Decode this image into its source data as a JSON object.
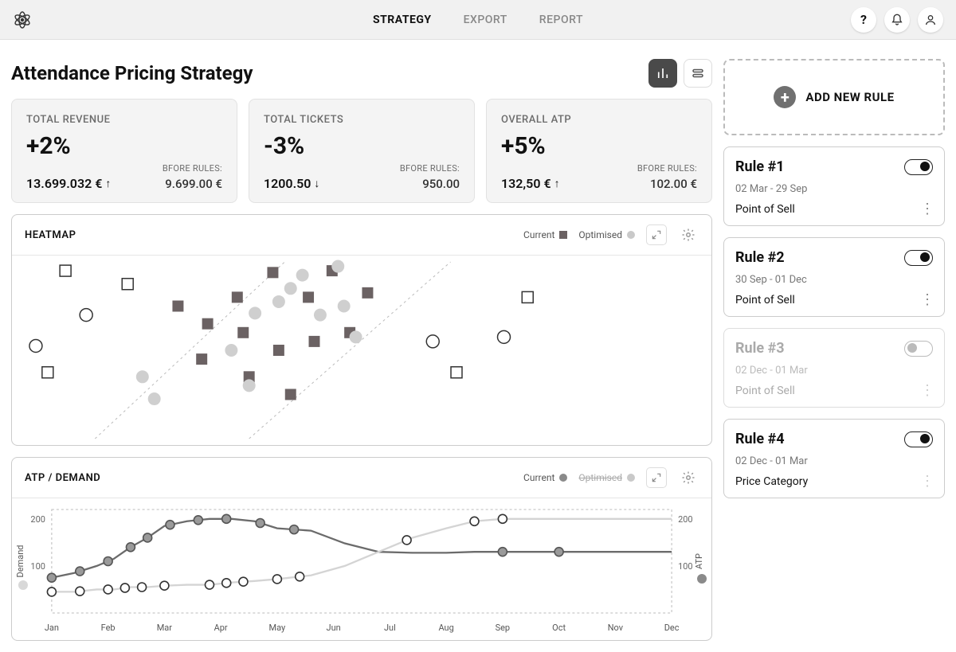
{
  "header": {
    "nav": [
      {
        "label": "STRATEGY",
        "active": true
      },
      {
        "label": "EXPORT",
        "active": false
      },
      {
        "label": "REPORT",
        "active": false
      }
    ]
  },
  "page_title": "Attendance Pricing Strategy",
  "stat_cards": {
    "before_label": "BFORE RULES:",
    "cards": [
      {
        "title": "TOTAL REVENUE",
        "pct": "+2%",
        "value": "13.699.032 €",
        "arrow": "↑",
        "before": "9.699.00 €"
      },
      {
        "title": "TOTAL TICKETS",
        "pct": "-3%",
        "value": "1200.50",
        "arrow": "↓",
        "before": "950.00"
      },
      {
        "title": "OVERALL ATP",
        "pct": "+5%",
        "value": "132,50 €",
        "arrow": "↑",
        "before": "102.00 €"
      }
    ]
  },
  "heatmap": {
    "title": "HEATMAP",
    "legend": {
      "current": "Current",
      "optimised": "Optimised"
    }
  },
  "atp": {
    "title": "ATP / DEMAND",
    "legend": {
      "current": "Current",
      "optimised": "Optimised"
    },
    "y_left_label": "Demand",
    "y_right_label": "ATP",
    "y_left_ticks": [
      "200",
      "100"
    ],
    "y_right_ticks": [
      "200",
      "100"
    ],
    "x_ticks": [
      "Jan",
      "Feb",
      "Mar",
      "Apr",
      "May",
      "Jun",
      "Jul",
      "Aug",
      "Sep",
      "Oct",
      "Nov",
      "Dec"
    ]
  },
  "sidebar": {
    "add_label": "ADD NEW RULE",
    "rules": [
      {
        "name": "Rule #1",
        "dates": "02 Mar - 29 Sep",
        "type": "Point of Sell",
        "enabled": true
      },
      {
        "name": "Rule #2",
        "dates": "30 Sep - 01 Dec",
        "type": "Point of Sell",
        "enabled": true
      },
      {
        "name": "Rule #3",
        "dates": "02 Dec - 01 Mar",
        "type": "Point of Sell",
        "enabled": false
      },
      {
        "name": "Rule #4",
        "dates": "02 Dec - 01 Mar",
        "type": "Price Category",
        "enabled": true
      }
    ]
  },
  "chart_data": [
    {
      "id": "heatmap",
      "type": "scatter",
      "x_axis": "month",
      "categories": [
        "Jan",
        "Feb",
        "Mar",
        "Apr",
        "May",
        "Jun",
        "Jul",
        "Aug",
        "Sep",
        "Oct",
        "Nov",
        "Dec"
      ],
      "series": [
        {
          "name": "Current",
          "marker": "square-filled",
          "points": [
            {
              "x": 3.4,
              "y": 150
            },
            {
              "x": 3.9,
              "y": 130
            },
            {
              "x": 3.8,
              "y": 90
            },
            {
              "x": 4.4,
              "y": 160
            },
            {
              "x": 4.5,
              "y": 120
            },
            {
              "x": 4.6,
              "y": 70
            },
            {
              "x": 5.0,
              "y": 188
            },
            {
              "x": 5.1,
              "y": 100
            },
            {
              "x": 5.3,
              "y": 50
            },
            {
              "x": 5.6,
              "y": 160
            },
            {
              "x": 5.7,
              "y": 110
            },
            {
              "x": 6.0,
              "y": 190
            },
            {
              "x": 6.3,
              "y": 120
            },
            {
              "x": 6.6,
              "y": 165
            }
          ]
        },
        {
          "name": "Optimised",
          "marker": "circle-filled",
          "points": [
            {
              "x": 2.8,
              "y": 70
            },
            {
              "x": 3.0,
              "y": 45
            },
            {
              "x": 4.3,
              "y": 100
            },
            {
              "x": 4.6,
              "y": 60
            },
            {
              "x": 4.7,
              "y": 142
            },
            {
              "x": 5.1,
              "y": 155
            },
            {
              "x": 5.3,
              "y": 170
            },
            {
              "x": 5.5,
              "y": 185
            },
            {
              "x": 5.8,
              "y": 140
            },
            {
              "x": 6.1,
              "y": 195
            },
            {
              "x": 6.2,
              "y": 150
            },
            {
              "x": 6.4,
              "y": 115
            }
          ]
        },
        {
          "name": "Outliers-circle",
          "marker": "circle-open",
          "points": [
            {
              "x": 1.0,
              "y": 105
            },
            {
              "x": 1.85,
              "y": 140
            },
            {
              "x": 7.7,
              "y": 110
            },
            {
              "x": 8.9,
              "y": 115
            }
          ]
        },
        {
          "name": "Outliers-square",
          "marker": "square-open",
          "points": [
            {
              "x": 1.2,
              "y": 75
            },
            {
              "x": 1.5,
              "y": 190
            },
            {
              "x": 2.55,
              "y": 175
            },
            {
              "x": 8.1,
              "y": 75
            },
            {
              "x": 9.3,
              "y": 160
            }
          ]
        }
      ],
      "bands": [
        [
          2.0,
          5.2
        ],
        [
          4.6,
          8.0
        ]
      ]
    },
    {
      "id": "atp_demand",
      "type": "line",
      "x_axis": "month",
      "categories": [
        "Jan",
        "Feb",
        "Mar",
        "Apr",
        "May",
        "Jun",
        "Jul",
        "Aug",
        "Sep",
        "Oct",
        "Nov",
        "Dec"
      ],
      "ylim": [
        0,
        220
      ],
      "series": [
        {
          "name": "Demand (Current)",
          "axis": "left",
          "values": [
            75,
            85,
            100,
            115,
            140,
            160,
            185,
            195,
            200,
            200,
            195,
            180,
            175,
            148,
            130,
            128,
            128,
            130,
            130,
            130,
            130,
            130,
            130
          ],
          "x": [
            1,
            1.4,
            1.8,
            2.1,
            2.4,
            2.7,
            3.0,
            3.4,
            3.8,
            4.2,
            4.6,
            5.0,
            5.6,
            6.2,
            6.8,
            7.4,
            8.0,
            8.5,
            9.0,
            9.5,
            10.0,
            11.0,
            12.0
          ]
        },
        {
          "name": "ATP (Optimised)",
          "axis": "right",
          "values": [
            45,
            45,
            50,
            50,
            55,
            55,
            58,
            60,
            60,
            65,
            68,
            72,
            80,
            100,
            130,
            160,
            180,
            195,
            200,
            200,
            200,
            200,
            200
          ],
          "x": [
            1,
            1.4,
            1.8,
            2.1,
            2.4,
            2.7,
            3.0,
            3.4,
            3.8,
            4.2,
            4.6,
            5.0,
            5.6,
            6.2,
            6.8,
            7.4,
            8.0,
            8.5,
            9.0,
            9.5,
            10.0,
            11.0,
            12.0
          ]
        }
      ],
      "markers": {
        "Demand (Current)": [
          1.0,
          1.5,
          2.0,
          2.4,
          2.7,
          3.1,
          3.6,
          4.1,
          4.7,
          5.3,
          9.0,
          10.0
        ],
        "ATP (Optimised)": [
          1.0,
          1.5,
          2.0,
          2.3,
          2.6,
          3.0,
          3.8,
          4.1,
          4.4,
          5.0,
          5.4,
          7.3,
          8.5,
          9.0
        ]
      }
    }
  ]
}
